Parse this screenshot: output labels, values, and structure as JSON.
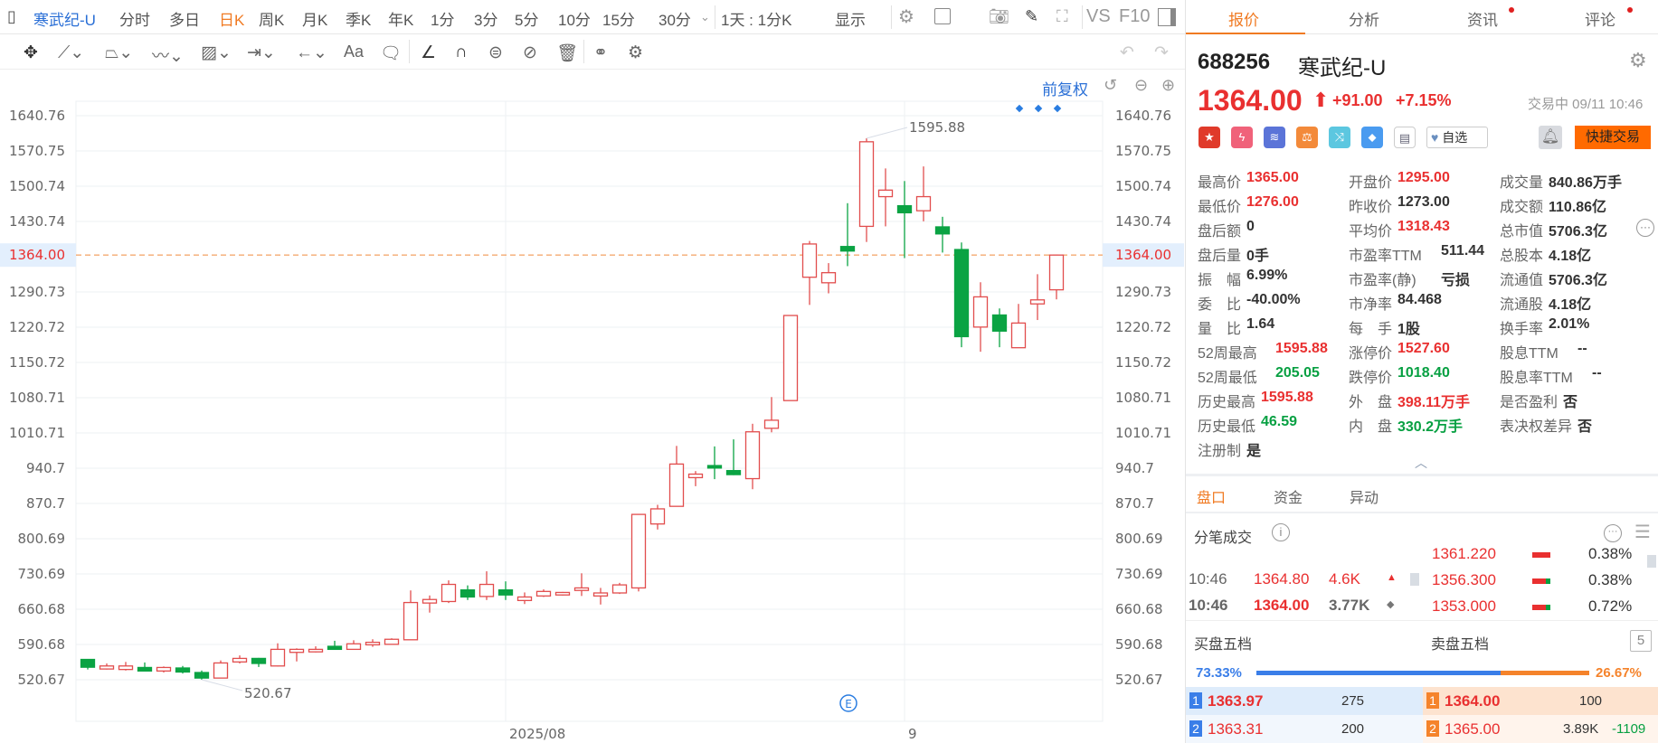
{
  "toolbar": {
    "panel_toggle": "▯",
    "stock_name": "寒武纪-U",
    "periods": [
      "分时",
      "多日",
      "日K",
      "周K",
      "月K",
      "季K",
      "年K",
      "1分",
      "3分",
      "5分",
      "10分",
      "15分",
      "30分"
    ],
    "active_period": "日K",
    "more_arrow": "⌄",
    "interval": "1天 : 1分K",
    "display": "显示",
    "vs": "VS",
    "f10": "F10"
  },
  "draw_tools": {
    "text_tool": "Aa"
  },
  "chart_header": {
    "adjust": "前复权"
  },
  "chart_data": {
    "type": "candlestick",
    "title": "寒武纪-U 日K",
    "ylim": [
      520.67,
      1640.76
    ],
    "yticks": [
      1640.76,
      1570.75,
      1500.74,
      1430.74,
      1290.73,
      1220.72,
      1150.72,
      1080.71,
      1010.71,
      940.7,
      870.7,
      800.69,
      730.69,
      660.68,
      590.68,
      520.67
    ],
    "current_price": 1364.0,
    "current_price_label": "1364.00",
    "max_label": "1595.88",
    "min_label": "520.67",
    "max_index": 41,
    "min_index": 6,
    "xlabels": [
      {
        "index": 22,
        "label": "2025/08"
      },
      {
        "index": 43,
        "label": "9"
      }
    ],
    "event_marker": {
      "index": 41,
      "label": "E"
    },
    "ohlc": [
      [
        561,
        561,
        541,
        545.5
      ],
      [
        542,
        553,
        541,
        548
      ],
      [
        541,
        556,
        539,
        548
      ],
      [
        545,
        555,
        538,
        538
      ],
      [
        538,
        547,
        535,
        545
      ],
      [
        544,
        548,
        533,
        536
      ],
      [
        535,
        539,
        520.67,
        524
      ],
      [
        524,
        559,
        524,
        554
      ],
      [
        556,
        569,
        553,
        563
      ],
      [
        563,
        564,
        546,
        553
      ],
      [
        548,
        593,
        547,
        581
      ],
      [
        575,
        583,
        557,
        581
      ],
      [
        576,
        587,
        575,
        581
      ],
      [
        587,
        598,
        580,
        581
      ],
      [
        581,
        599,
        580,
        592
      ],
      [
        590,
        601,
        586,
        595
      ],
      [
        591,
        603,
        591,
        601
      ],
      [
        600,
        698,
        600,
        674
      ],
      [
        673,
        688,
        654,
        680
      ],
      [
        676,
        718,
        673,
        710
      ],
      [
        699,
        708,
        679,
        685
      ],
      [
        686,
        736,
        679,
        710
      ],
      [
        699,
        716,
        679,
        689
      ],
      [
        678,
        694,
        671,
        685
      ],
      [
        687,
        700,
        685,
        696
      ],
      [
        689,
        695,
        688,
        694
      ],
      [
        698,
        732,
        687,
        703
      ],
      [
        687,
        703,
        670,
        693
      ],
      [
        693,
        713,
        691,
        709
      ],
      [
        703,
        849,
        696,
        849
      ],
      [
        830,
        868,
        819,
        860
      ],
      [
        865,
        985,
        865,
        949
      ],
      [
        922,
        935,
        905,
        929
      ],
      [
        946,
        984,
        919,
        941
      ],
      [
        936,
        998,
        927,
        928
      ],
      [
        920,
        1029,
        899,
        1013
      ],
      [
        1020,
        1082,
        1012,
        1036
      ],
      [
        1075,
        1244,
        1075,
        1244
      ],
      [
        1320,
        1392,
        1265,
        1386
      ],
      [
        1309,
        1348,
        1288,
        1329
      ],
      [
        1381,
        1467,
        1342,
        1372
      ],
      [
        1421,
        1595.88,
        1390,
        1589
      ],
      [
        1480,
        1536,
        1421,
        1493
      ],
      [
        1462,
        1511,
        1358,
        1448
      ],
      [
        1452,
        1540,
        1431,
        1480
      ],
      [
        1420,
        1440,
        1369,
        1406
      ],
      [
        1375,
        1389,
        1181,
        1202
      ],
      [
        1221,
        1310,
        1172,
        1281
      ],
      [
        1245,
        1258,
        1181,
        1213
      ],
      [
        1180,
        1267,
        1180,
        1229
      ],
      [
        1267,
        1326,
        1235,
        1275
      ],
      [
        1295,
        1365,
        1276,
        1364
      ]
    ],
    "colors": {
      "up": "#e24d4d",
      "down": "#0aa343",
      "last": "#f08a3c"
    }
  },
  "tabs": [
    {
      "label": "报价",
      "dot": false
    },
    {
      "label": "分析",
      "dot": false
    },
    {
      "label": "资讯",
      "dot": true
    },
    {
      "label": "评论",
      "dot": true
    }
  ],
  "quote": {
    "code": "688256",
    "name": "寒武纪-U",
    "price": "1364.00",
    "arrow": "⬆",
    "change": "+91.00",
    "pct": "+7.15%",
    "status": "交易中 09/11 10:46",
    "watch": "自选",
    "quick_trade": "快捷交易"
  },
  "stats": [
    [
      {
        "l": "最高价",
        "v": "1365.00",
        "c": "red"
      },
      {
        "l": "开盘价",
        "v": "1295.00",
        "c": "red"
      },
      {
        "l": "成交量",
        "v": "840.86万手",
        "c": "dk"
      }
    ],
    [
      {
        "l": "最低价",
        "v": "1276.00",
        "c": "red"
      },
      {
        "l": "昨收价",
        "v": "1273.00",
        "c": "dk"
      },
      {
        "l": "成交额",
        "v": "110.86亿",
        "c": "dk"
      }
    ],
    [
      {
        "l": "盘后额",
        "v": "0",
        "c": "dk"
      },
      {
        "l": "平均价",
        "v": "1318.43",
        "c": "red"
      },
      {
        "l": "总市值",
        "v": "5706.3亿",
        "c": "dk"
      }
    ],
    [
      {
        "l": "盘后量",
        "v": "0手",
        "c": "dk"
      },
      {
        "l": "市盈率TTM",
        "v": "511.44",
        "c": "dk"
      },
      {
        "l": "总股本",
        "v": "4.18亿",
        "c": "dk"
      }
    ],
    [
      {
        "l": "振　幅",
        "v": "6.99%",
        "c": "dk"
      },
      {
        "l": "市盈率(静)",
        "v": "亏损",
        "c": "dk"
      },
      {
        "l": "流通值",
        "v": "5706.3亿",
        "c": "dk"
      }
    ],
    [
      {
        "l": "委　比",
        "v": "-40.00%",
        "c": "dk"
      },
      {
        "l": "市净率",
        "v": "84.468",
        "c": "dk"
      },
      {
        "l": "流通股",
        "v": "4.18亿",
        "c": "dk"
      }
    ],
    [
      {
        "l": "量　比",
        "v": "1.64",
        "c": "dk"
      },
      {
        "l": "每　手",
        "v": "1股",
        "c": "dk"
      },
      {
        "l": "换手率",
        "v": "2.01%",
        "c": "dk"
      }
    ],
    [
      {
        "l": "52周最高",
        "v": "1595.88",
        "c": "red"
      },
      {
        "l": "涨停价",
        "v": "1527.60",
        "c": "red"
      },
      {
        "l": "股息TTM",
        "v": "--",
        "c": "dk"
      }
    ],
    [
      {
        "l": "52周最低",
        "v": "205.05",
        "c": "grn"
      },
      {
        "l": "跌停价",
        "v": "1018.40",
        "c": "grn"
      },
      {
        "l": "股息率TTM",
        "v": "--",
        "c": "dk"
      }
    ],
    [
      {
        "l": "历史最高",
        "v": "1595.88",
        "c": "red"
      },
      {
        "l": "外　盘",
        "v": "398.11万手",
        "c": "red"
      },
      {
        "l": "是否盈利",
        "v": "否",
        "c": "dk"
      }
    ],
    [
      {
        "l": "历史最低",
        "v": "46.59",
        "c": "grn"
      },
      {
        "l": "内　盘",
        "v": "330.2万手",
        "c": "grn"
      },
      {
        "l": "表决权差异",
        "v": "否",
        "c": "dk"
      }
    ],
    [
      {
        "l": "注册制",
        "v": "是",
        "c": "dk"
      }
    ]
  ],
  "subtabs": [
    "盘口",
    "资金",
    "异动"
  ],
  "ticks": {
    "title": "分笔成交",
    "rows": [
      {
        "time": "10:46",
        "price": "1364.80",
        "vol": "4.6K",
        "mark": "▲"
      },
      {
        "time": "10:46",
        "price": "1364.00",
        "vol": "3.77K",
        "mark": "◆"
      }
    ],
    "dist": [
      {
        "price": "1361.220",
        "pct": "0.38%"
      },
      {
        "price": "1356.300",
        "pct": "0.38%"
      },
      {
        "price": "1353.000",
        "pct": "0.72%"
      }
    ]
  },
  "book": {
    "buy_title": "买盘五档",
    "sell_title": "卖盘五档",
    "levels_btn": "5",
    "buy_pct": "73.33%",
    "sell_pct": "26.67%",
    "buy_ratio": 0.7333,
    "buy": [
      {
        "n": "1",
        "p": "1363.97",
        "q": "275"
      },
      {
        "n": "2",
        "p": "1363.31",
        "q": "200"
      }
    ],
    "sell": [
      {
        "n": "1",
        "p": "1364.00",
        "q": "100",
        "d": ""
      },
      {
        "n": "2",
        "p": "1365.00",
        "q": "3.89K",
        "d": "-1109"
      }
    ]
  }
}
